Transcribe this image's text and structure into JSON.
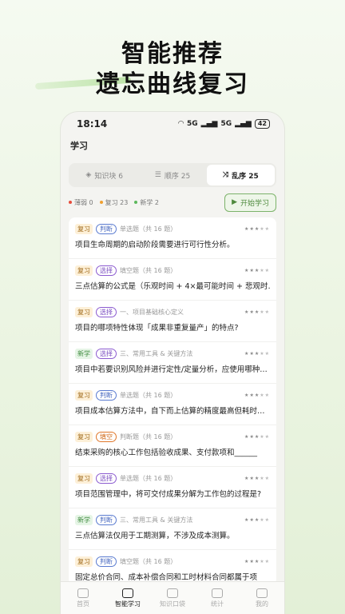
{
  "hero": {
    "line1": "智能推荐",
    "line2": "遗忘曲线复习"
  },
  "status_bar": {
    "time": "18:14",
    "network": "5G",
    "network2": "5G",
    "battery": "42"
  },
  "page_title": "学习",
  "segments": [
    {
      "label": "知识块 6",
      "icon": "cube-icon",
      "active": false
    },
    {
      "label": "顺序 25",
      "icon": "list-icon",
      "active": false
    },
    {
      "label": "乱序 25",
      "icon": "shuffle-icon",
      "active": true
    }
  ],
  "legend": [
    {
      "label": "薄弱 0",
      "color": "#e74c3c"
    },
    {
      "label": "复习 23",
      "color": "#f0a030"
    },
    {
      "label": "新学 2",
      "color": "#5cb85c"
    }
  ],
  "start_button": "开始学习",
  "items": [
    {
      "status": "复习",
      "type": "判断",
      "meta": "单选题（共 16 题）",
      "stars": 3,
      "text": "项目生命周期的启动阶段需要进行可行性分析。"
    },
    {
      "status": "复习",
      "type": "选择",
      "meta": "填空题（共 16 题）",
      "stars": 3,
      "text": "三点估算的公式是（乐观时间 + 4×最可能时间 + 悲观时…"
    },
    {
      "status": "复习",
      "type": "选择",
      "meta": "一、项目基础核心定义",
      "stars": 3,
      "text": "项目的哪项特性体现「成果非重复量产」的特点?"
    },
    {
      "status": "新学",
      "type": "选择",
      "meta": "三、常用工具 & 关键方法",
      "stars": 3,
      "text": "项目中若要识别风险并进行定性/定量分析，应使用哪种…"
    },
    {
      "status": "复习",
      "type": "判断",
      "meta": "单选题（共 16 题）",
      "stars": 3,
      "text": "项目成本估算方法中，自下而上估算的精度最高但耗时…"
    },
    {
      "status": "复习",
      "type": "填空",
      "meta": "判断题（共 16 题）",
      "stars": 3,
      "text": "结束采购的核心工作包括验收成果、支付款项和______"
    },
    {
      "status": "复习",
      "type": "选择",
      "meta": "单选题（共 16 题）",
      "stars": 3,
      "text": "项目范围管理中，将可交付成果分解为工作包的过程是?"
    },
    {
      "status": "新学",
      "type": "判断",
      "meta": "三、常用工具 & 关键方法",
      "stars": 3,
      "text": "三点估算法仅用于工期测算，不涉及成本测算。"
    },
    {
      "status": "复习",
      "type": "判断",
      "meta": "填空题（共 16 题）",
      "stars": 3,
      "text": "固定总价合同、成本补偿合同和工时材料合同都属于项"
    }
  ],
  "tabs": [
    {
      "label": "首页",
      "icon": "home-icon",
      "active": false
    },
    {
      "label": "智能学习",
      "icon": "book-icon",
      "active": true
    },
    {
      "label": "知识口袋",
      "icon": "pocket-icon",
      "active": false
    },
    {
      "label": "统计",
      "icon": "chart-icon",
      "active": false
    },
    {
      "label": "我的",
      "icon": "user-icon",
      "active": false
    }
  ]
}
